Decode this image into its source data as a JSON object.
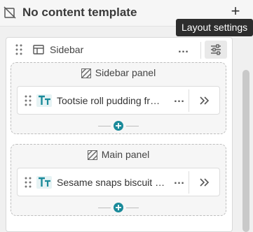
{
  "header": {
    "title": "No content template",
    "add_label": "+",
    "template_icon": "template-slash-icon"
  },
  "tooltip": {
    "text": "Layout settings"
  },
  "sidebar": {
    "label": "Sidebar",
    "more_label": "…",
    "icons": [
      "drag-handle-icon",
      "layout-icon",
      "more-icon",
      "settings-sliders-icon"
    ],
    "panels": [
      {
        "title": "Sidebar panel",
        "card_text": "Tootsie roll pudding fr…",
        "card_icon": "text-type-icon"
      },
      {
        "title": "Main panel",
        "card_text": "Sesame snaps biscuit …",
        "card_icon": "text-type-icon"
      }
    ]
  },
  "colors": {
    "accent": "#1a8a9a",
    "tooltip_bg": "#2d2d2d",
    "panel_bg": "#f6f6f6"
  }
}
